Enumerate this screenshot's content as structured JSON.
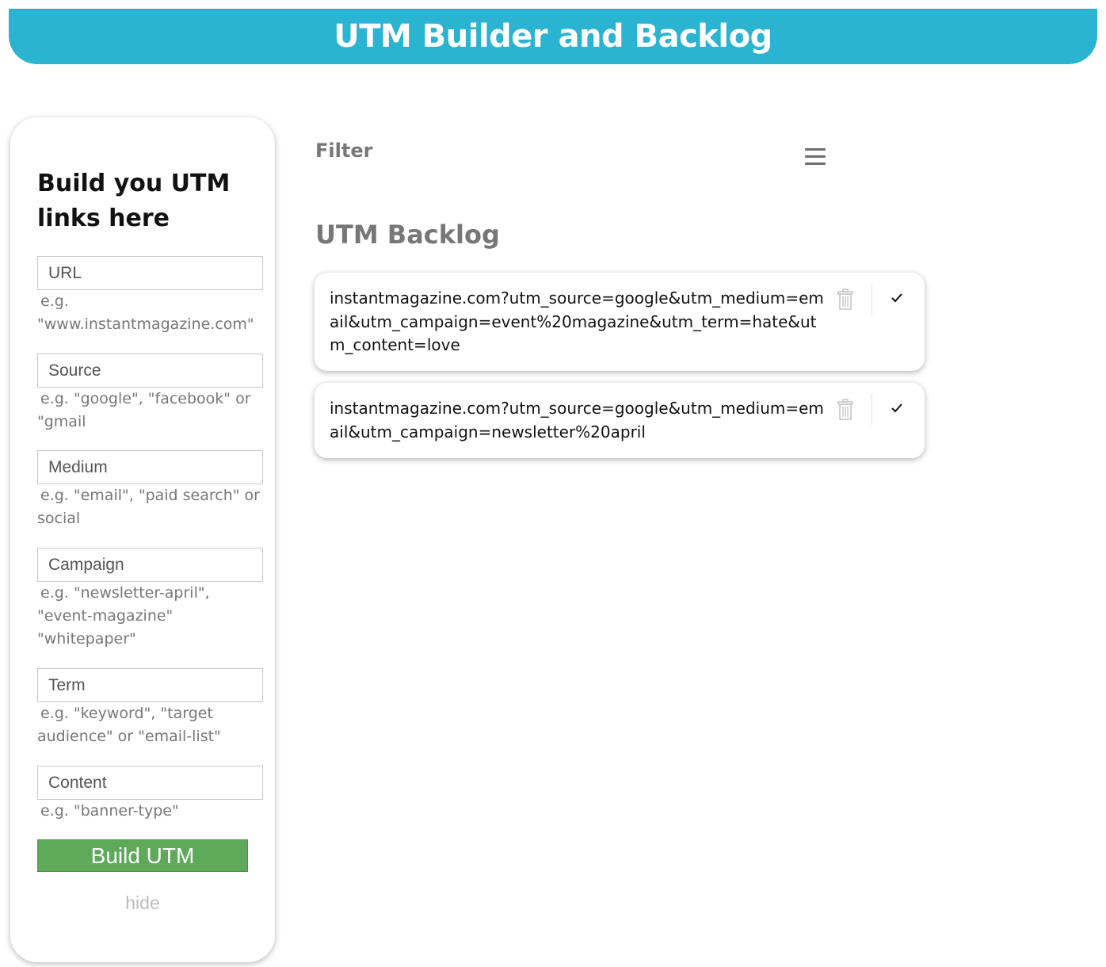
{
  "header": {
    "title": "UTM Builder and Backlog"
  },
  "builder": {
    "title": "Build you UTM links here",
    "fields": [
      {
        "placeholder": "URL",
        "hint": "e.g. \"www.instantmagazine.com\""
      },
      {
        "placeholder": "Source",
        "hint": "e.g. \"google\", \"facebook\" or \"gmail"
      },
      {
        "placeholder": "Medium",
        "hint": "e.g. \"email\", \"paid search\" or social"
      },
      {
        "placeholder": "Campaign",
        "hint": "e.g. \"newsletter-april\", \"event-magazine\" \"whitepaper\""
      },
      {
        "placeholder": "Term",
        "hint": "e.g. \"keyword\", \"target audience\" or \"email-list\""
      },
      {
        "placeholder": "Content",
        "hint": "e.g. \"banner-type\""
      }
    ],
    "build_button": "Build UTM",
    "hide_link": "hide"
  },
  "filter": {
    "label": "Filter",
    "menu_icon": "hamburger-menu-icon"
  },
  "backlog": {
    "title": "UTM Backlog",
    "items": [
      {
        "url": "instantmagazine.com?utm_source=google&utm_medium=email&utm_campaign=event%20magazine&utm_term=hate&utm_content=love"
      },
      {
        "url": "instantmagazine.com?utm_source=google&utm_medium=email&utm_campaign=newsletter%20april"
      }
    ]
  },
  "colors": {
    "header": "#2bb3d2",
    "build_button": "#5eaa5a",
    "muted_text": "#777777"
  }
}
